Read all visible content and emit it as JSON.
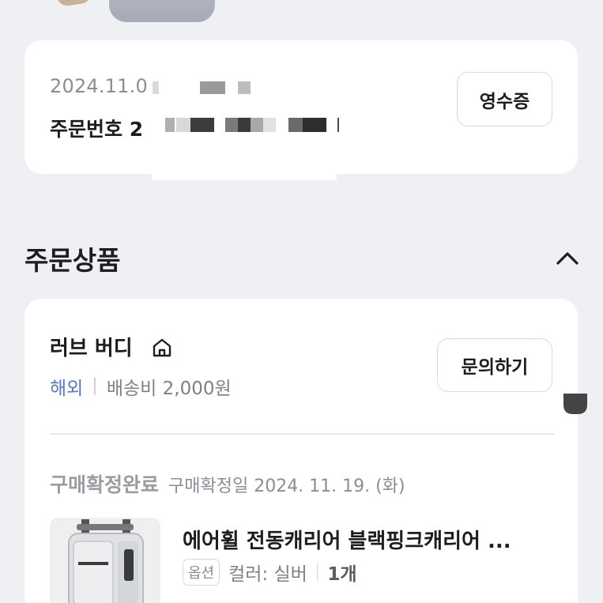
{
  "order": {
    "date": "2024.11.0",
    "number_label": "주문번호 2",
    "receipt_button": "영수증"
  },
  "section": {
    "title": "주문상품"
  },
  "seller": {
    "name": "러브 버디",
    "origin": "해외",
    "shipping_fee": "배송비 2,000원",
    "inquiry_button": "문의하기"
  },
  "product": {
    "status": "구매확정완료",
    "confirm_date": "구매확정일 2024. 11. 19. (화)",
    "name": "에어휠 전동캐리어 블랙핑크캐리어 ...",
    "option_badge": "옵션",
    "option_value": "컬러: 실버",
    "quantity": "1개"
  },
  "colors": {
    "background": "#eff0f4",
    "card": "#ffffff",
    "overseas_accent": "#5a77c8",
    "muted_text": "#8a8d93"
  }
}
